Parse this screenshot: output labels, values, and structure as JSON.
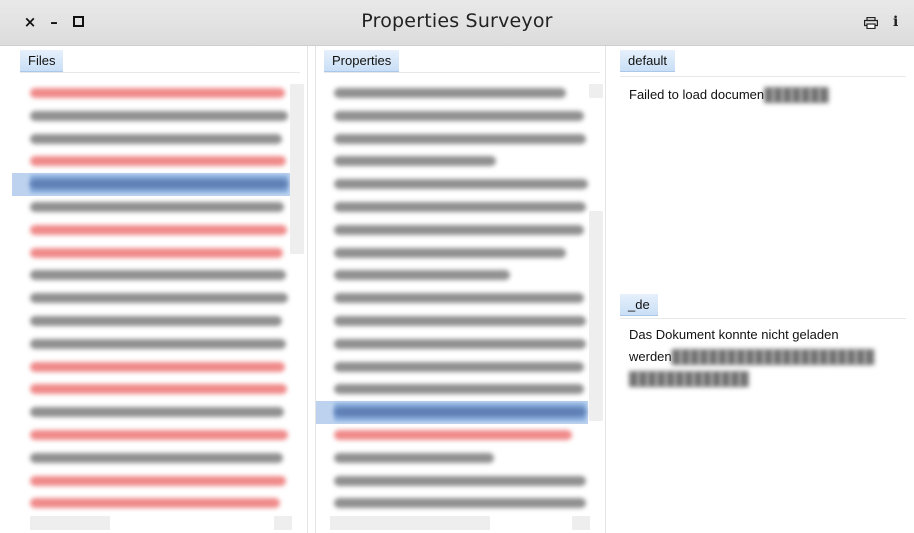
{
  "window": {
    "title": "Properties Surveyor",
    "close_glyph": "×",
    "minimize_glyph": "–",
    "info_glyph": "i",
    "icons": [
      "close-icon",
      "minimize-icon",
      "maximize-icon",
      "print-icon",
      "info-icon"
    ]
  },
  "files_pane": {
    "header": "Files",
    "rows": [
      {
        "color": "red",
        "selected": false
      },
      {
        "color": "black",
        "selected": false
      },
      {
        "color": "black",
        "selected": false
      },
      {
        "color": "red",
        "selected": false
      },
      {
        "color": "red",
        "selected": true
      },
      {
        "color": "black",
        "selected": false
      },
      {
        "color": "red",
        "selected": false
      },
      {
        "color": "red",
        "selected": false
      },
      {
        "color": "black",
        "selected": false
      },
      {
        "color": "black",
        "selected": false
      },
      {
        "color": "black",
        "selected": false
      },
      {
        "color": "black",
        "selected": false
      },
      {
        "color": "red",
        "selected": false
      },
      {
        "color": "red",
        "selected": false
      },
      {
        "color": "black",
        "selected": false
      },
      {
        "color": "red",
        "selected": false
      },
      {
        "color": "black",
        "selected": false
      },
      {
        "color": "red",
        "selected": false
      },
      {
        "color": "red",
        "selected": false
      }
    ]
  },
  "properties_pane": {
    "header": "Properties",
    "rows": [
      {
        "color": "black",
        "selected": false
      },
      {
        "color": "black",
        "selected": false
      },
      {
        "color": "black",
        "selected": false
      },
      {
        "color": "black",
        "selected": false
      },
      {
        "color": "black",
        "selected": false
      },
      {
        "color": "black",
        "selected": false
      },
      {
        "color": "black",
        "selected": false
      },
      {
        "color": "black",
        "selected": false
      },
      {
        "color": "black",
        "selected": false
      },
      {
        "color": "black",
        "selected": false
      },
      {
        "color": "black",
        "selected": false
      },
      {
        "color": "black",
        "selected": false
      },
      {
        "color": "black",
        "selected": false
      },
      {
        "color": "black",
        "selected": false
      },
      {
        "color": "black",
        "selected": true
      },
      {
        "color": "red",
        "selected": false
      },
      {
        "color": "black",
        "selected": false
      },
      {
        "color": "black",
        "selected": false
      },
      {
        "color": "black",
        "selected": false
      }
    ]
  },
  "locale_default": {
    "header": "default",
    "message_visible": "Failed to load documen"
  },
  "locale_de": {
    "header": "_de",
    "message_line1": "Das Dokument konnte nicht geladen",
    "message_line2_visible": "werden"
  },
  "colors": {
    "selection": "#bcd2ef",
    "tab_header": "#c9dff6",
    "error_text": "#f08a8a"
  }
}
